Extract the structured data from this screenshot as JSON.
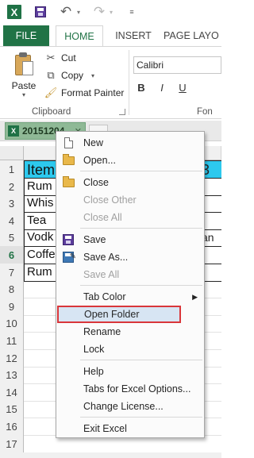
{
  "quick_access": {
    "app_icon": "excel-icon",
    "app_icon_letter": "X",
    "save_icon": "save-icon",
    "undo_glyph": "↶",
    "redo_glyph": "↷",
    "dropdown_glyph": "▾",
    "customize_glyph": "≡"
  },
  "ribbon_tabs": {
    "file": "FILE",
    "home": "HOME",
    "insert": "INSERT",
    "page_layout": "PAGE LAYO"
  },
  "clipboard": {
    "paste": "Paste",
    "paste_drop": "▾",
    "cut": "Cut",
    "copy": "Copy",
    "copy_drop": "▾",
    "format_painter": "Format Painter",
    "group_label": "Clipboard"
  },
  "font_group": {
    "font_name": "Calibri",
    "bold": "B",
    "italic": "I",
    "underline": "U",
    "group_label": "Fon"
  },
  "sheet_tab": {
    "name": "20151204",
    "close_glyph": "✕"
  },
  "grid": {
    "rows": [
      {
        "num": "1",
        "a": "Item",
        "right": "3"
      },
      {
        "num": "2",
        "a": "Rum",
        "right": ""
      },
      {
        "num": "3",
        "a": "Whis",
        "right": ""
      },
      {
        "num": "4",
        "a": "Tea",
        "right": ""
      },
      {
        "num": "5",
        "a": "Vodk",
        "right": "an"
      },
      {
        "num": "6",
        "a": "Coffe",
        "right": ""
      },
      {
        "num": "7",
        "a": "Rum",
        "right": ""
      },
      {
        "num": "8",
        "a": "",
        "right": ""
      },
      {
        "num": "9",
        "a": "",
        "right": ""
      },
      {
        "num": "10",
        "a": "",
        "right": ""
      },
      {
        "num": "11",
        "a": "",
        "right": ""
      },
      {
        "num": "12",
        "a": "",
        "right": ""
      },
      {
        "num": "13",
        "a": "",
        "right": ""
      },
      {
        "num": "14",
        "a": "",
        "right": ""
      },
      {
        "num": "15",
        "a": "",
        "right": ""
      },
      {
        "num": "16",
        "a": "",
        "right": ""
      },
      {
        "num": "17",
        "a": "",
        "right": ""
      }
    ],
    "header_color": "#2dc9ee",
    "selected_row": "6"
  },
  "context_menu": {
    "items": [
      {
        "label": "New",
        "icon": "new-document-icon",
        "enabled": true
      },
      {
        "label": "Open...",
        "icon": "open-folder-icon",
        "enabled": true
      },
      {
        "label": "Close",
        "icon": "close-document-icon",
        "enabled": true
      },
      {
        "label": "Close Other",
        "icon": "",
        "enabled": false
      },
      {
        "label": "Close All",
        "icon": "",
        "enabled": false
      },
      {
        "label": "Save",
        "icon": "save-icon",
        "enabled": true
      },
      {
        "label": "Save As...",
        "icon": "save-as-icon",
        "enabled": true
      },
      {
        "label": "Save All",
        "icon": "",
        "enabled": false
      },
      {
        "label": "Tab Color",
        "icon": "",
        "enabled": true,
        "submenu": "▶"
      },
      {
        "label": "Open Folder",
        "icon": "",
        "enabled": true,
        "highlighted": true
      },
      {
        "label": "Rename",
        "icon": "",
        "enabled": true
      },
      {
        "label": "Lock",
        "icon": "",
        "enabled": true
      },
      {
        "label": "Help",
        "icon": "",
        "enabled": true
      },
      {
        "label": "Tabs for Excel Options...",
        "icon": "",
        "enabled": true
      },
      {
        "label": "Change License...",
        "icon": "",
        "enabled": true
      },
      {
        "label": "Exit Excel",
        "icon": "",
        "enabled": true
      }
    ],
    "highlight_border_color": "#d9363a",
    "highlight_fill_color": "#d7e5f3"
  }
}
